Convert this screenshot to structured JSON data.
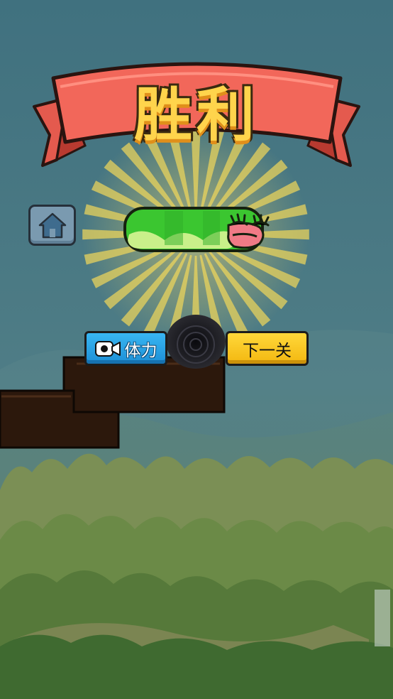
{
  "title": "胜利",
  "buttons": {
    "stamina_label": "体力",
    "next_label": "下一关"
  },
  "icons": {
    "home": "home-icon",
    "video": "video-camera-icon"
  },
  "colors": {
    "banner": "#f2675a",
    "title": "#ffd44c",
    "stamina_button": "#2ba3e6",
    "next_button": "#fac929",
    "snake": "#37c22e"
  }
}
